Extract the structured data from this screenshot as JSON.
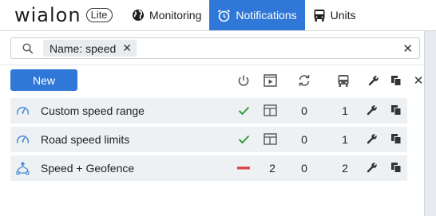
{
  "app": {
    "logo_text": "wialon",
    "badge": "Lite"
  },
  "nav": [
    {
      "label": "Monitoring",
      "icon": "globe-icon"
    },
    {
      "label": "Notifications",
      "icon": "alarm-clock-icon",
      "active": true
    },
    {
      "label": "Units",
      "icon": "bus-icon"
    }
  ],
  "search": {
    "filter_chip": "Name: speed"
  },
  "toolbar": {
    "new_label": "New"
  },
  "notifications": [
    {
      "name": "Custom speed range",
      "type_icon": "speedometer-icon",
      "state": "enabled",
      "count_triggered": "",
      "count_actions": "0",
      "count_units": "1"
    },
    {
      "name": "Road speed limits",
      "type_icon": "speedometer-icon",
      "state": "enabled",
      "count_triggered": "",
      "count_actions": "0",
      "count_units": "1"
    },
    {
      "name": "Speed + Geofence",
      "type_icon": "geofence-icon",
      "state": "disabled",
      "count_triggered": "2",
      "count_actions": "0",
      "count_units": "2"
    }
  ],
  "colors": {
    "accent": "#2f78d7",
    "enabled": "#3a9a3c",
    "disabled": "#e04848"
  }
}
